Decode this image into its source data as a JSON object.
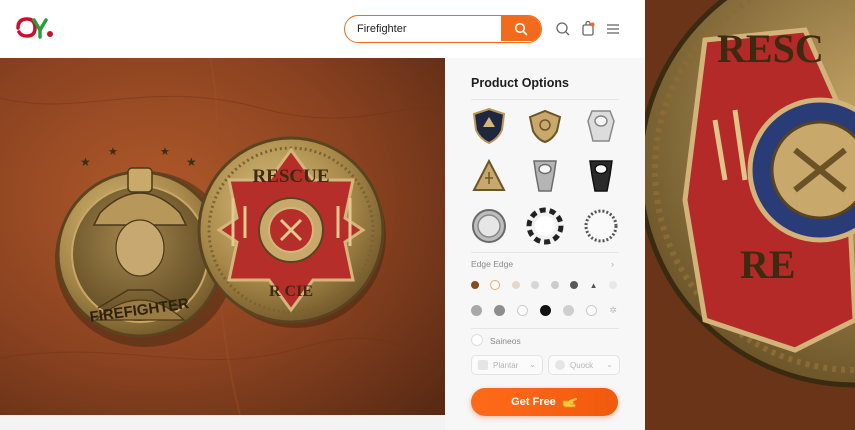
{
  "header": {
    "logo_text": "QY",
    "search": {
      "value": "Firefighter"
    }
  },
  "hero": {
    "coin_left_text": "FIREFIGHTER",
    "coin_right_top_text": "RESCUE",
    "coin_right_bottom_text": "R CIE"
  },
  "zoom": {
    "top_text": "RESC",
    "bottom_text": "RE"
  },
  "panel": {
    "title": "Product Options",
    "shapes": [
      "shield-shape",
      "crest-shape",
      "bottle-opener-shape",
      "triangle-shape",
      "bottle-opener-shape",
      "bottle-opener-shape",
      "round-edge-shape",
      "spinner-edge-shape",
      "rope-edge-shape"
    ],
    "edge_label": "Edge Edge",
    "color_row_1": [
      "#8b4a1a",
      "#f7e0c8",
      "#e8d6cb",
      "#d6d6d6",
      "#cccccc",
      "#5a5a5a",
      "#444444",
      "#e8e8e8"
    ],
    "color_row_2": [
      "#a8a8a8",
      "#8e8e8e",
      "#ffffff",
      "#111111",
      "#cfcfcf",
      "#ffffff",
      "#ededed"
    ],
    "size_label": "Saineos",
    "select_left": "Plantar",
    "select_right": "Quock",
    "cta_label": "Get Free"
  }
}
